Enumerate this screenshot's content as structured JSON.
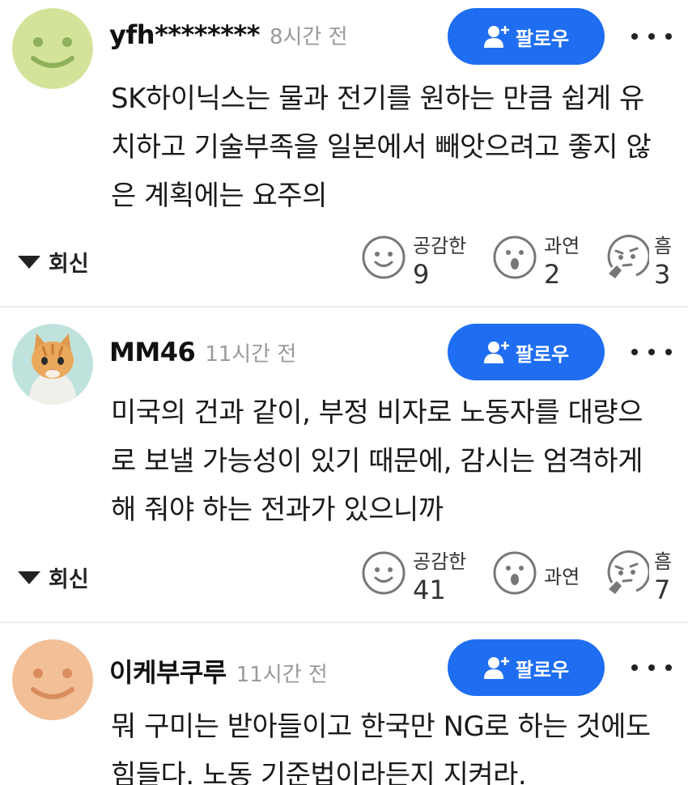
{
  "comments": [
    {
      "nickname": "yfh********",
      "time": "8시간 전",
      "follow_label": "팔로우",
      "lines": [
        "SK하이닉스는 물과 전기를 원하는 만큼 쉽게 유",
        "치하고 기술부족을 일본에서 빼앗으려고 좋지 않",
        "은 계획에는 요주의"
      ],
      "avatar": "smiley-green",
      "reply_label": "회신",
      "reactions": {
        "like": {
          "label": "공감한",
          "count": "9"
        },
        "wow": {
          "label": "과연",
          "count": "2"
        },
        "hmm": {
          "label": "흠",
          "count": "3"
        }
      }
    },
    {
      "nickname": "MM46",
      "time": "11시간 전",
      "follow_label": "팔로우",
      "lines": [
        "미국의 건과 같이, 부정 비자로 노동자를 대량으",
        "로 보낼 가능성이 있기 때문에, 감시는 엄격하게",
        "해 줘야 하는 전과가 있으니까"
      ],
      "avatar": "cat-photo",
      "reply_label": "회신",
      "reactions": {
        "like": {
          "label": "공감한",
          "count": "41"
        },
        "wow": {
          "label": "과연",
          "count": ""
        },
        "hmm": {
          "label": "흠",
          "count": "7"
        }
      }
    },
    {
      "nickname": "이케부쿠루",
      "time": "11시간 전",
      "follow_label": "팔로우",
      "lines": [
        "뭐 구미는 받아들이고 한국만 NG로 하는 것에도",
        "힘들다. 노동 기준법이라든지 지켜라."
      ],
      "avatar": "smiley-peach"
    }
  ],
  "colors": {
    "accent": "#1f6ef2",
    "avatar_green": "#d4e39a",
    "avatar_peach": "#f2bf97"
  }
}
